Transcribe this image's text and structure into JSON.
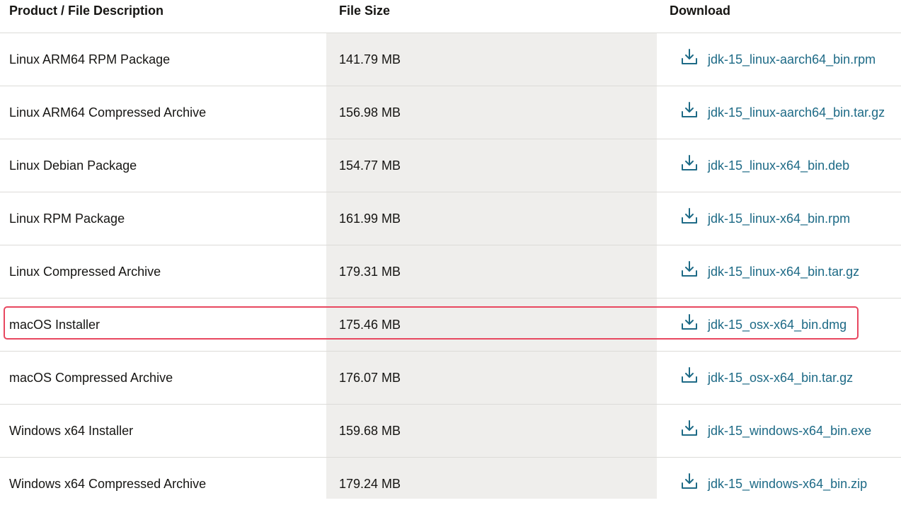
{
  "table": {
    "headers": {
      "description": "Product / File Description",
      "size": "File Size",
      "download": "Download"
    },
    "rows": [
      {
        "description": "Linux ARM64 RPM Package",
        "size": "141.79 MB",
        "file": "jdk-15_linux-aarch64_bin.rpm"
      },
      {
        "description": "Linux ARM64 Compressed Archive",
        "size": "156.98 MB",
        "file": "jdk-15_linux-aarch64_bin.tar.gz"
      },
      {
        "description": "Linux Debian Package",
        "size": "154.77 MB",
        "file": "jdk-15_linux-x64_bin.deb"
      },
      {
        "description": "Linux RPM Package",
        "size": "161.99 MB",
        "file": "jdk-15_linux-x64_bin.rpm"
      },
      {
        "description": "Linux Compressed Archive",
        "size": "179.31 MB",
        "file": "jdk-15_linux-x64_bin.tar.gz"
      },
      {
        "description": "macOS Installer",
        "size": "175.46 MB",
        "file": "jdk-15_osx-x64_bin.dmg"
      },
      {
        "description": "macOS Compressed Archive",
        "size": "176.07 MB",
        "file": "jdk-15_osx-x64_bin.tar.gz"
      },
      {
        "description": "Windows x64 Installer",
        "size": "159.68 MB",
        "file": "jdk-15_windows-x64_bin.exe"
      },
      {
        "description": "Windows x64 Compressed Archive",
        "size": "179.24 MB",
        "file": "jdk-15_windows-x64_bin.zip"
      }
    ]
  },
  "icons": {
    "download": "download-icon"
  },
  "colors": {
    "link": "#1d6a86",
    "highlight_border": "#e8475f",
    "size_column_bg": "#efeeec"
  }
}
